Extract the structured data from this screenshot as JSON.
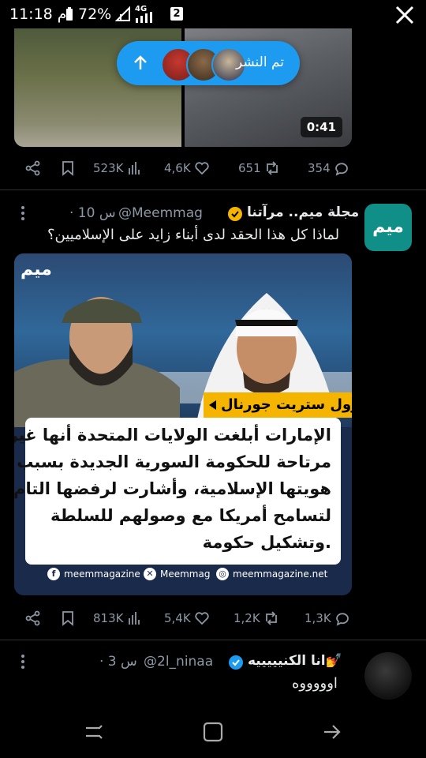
{
  "status_bar": {
    "time": "11:18 م",
    "battery": "72%",
    "network": "4G",
    "notif_count": "2"
  },
  "top_media": {
    "duration": "0:41"
  },
  "posted_pill": {
    "label": "تم النشر"
  },
  "tweet1_actions": {
    "views": "523K",
    "likes": "4,6K",
    "retweets": "651",
    "replies": "354"
  },
  "tweet2": {
    "name": "مجلة ميم.. مرآتنا",
    "handle": "@Meemmag",
    "time": "· 10 س",
    "text": "لماذا كل هذا الحقد لدى أبناء زايد على الإسلاميين؟",
    "avatar_text": "ميم",
    "card": {
      "logo": "ميم",
      "source": "وول ستريت جورنال",
      "lines": [
        "الإمارات أبلغت الولايات المتحدة أنها غير",
        "مرتاحة للحكومة السورية الجديدة بسبب",
        "هويتها الإسلامية، وأشارت لرفضها التام",
        "لتسامح أمريكا مع وصولهم للسلطة",
        "وتشكيل حكومة."
      ],
      "footer": {
        "facebook": "meemmagazine",
        "x": "Meemmag",
        "web": "meemmagazine.net"
      }
    },
    "actions": {
      "views": "813K",
      "likes": "5,4K",
      "retweets": "1,2K",
      "replies": "1,3K"
    }
  },
  "tweet3": {
    "name": "انا الكنيييييه💅",
    "handle": "@2l_ninaa",
    "time": "· 3 س",
    "text": "اوووووه"
  },
  "colors": {
    "accent": "#1d9bf0",
    "muted": "#8b98a5",
    "source_tag": "#f4b400",
    "verified_gold": "#f4b400",
    "verified_blue": "#1d9bf0"
  }
}
